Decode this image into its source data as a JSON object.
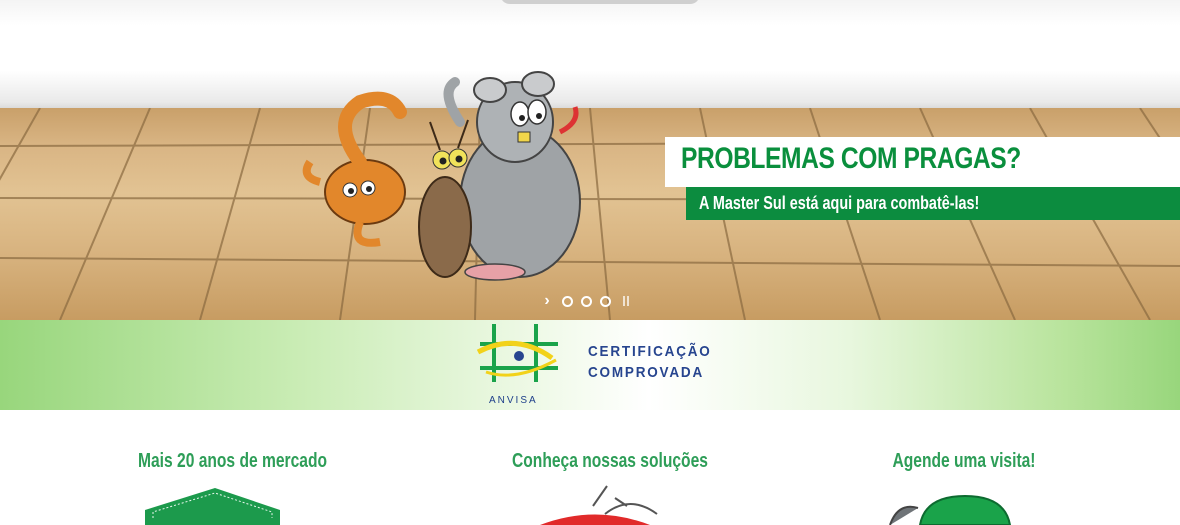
{
  "hero": {
    "title": "PROBLEMAS COM PRAGAS?",
    "subtitle": "A Master Sul está aqui para combatê-las!",
    "slider": {
      "next_arrow": "›",
      "dots": 3
    }
  },
  "certification": {
    "logo_label": "ANVISA",
    "line1": "CERTIFICAÇÃO",
    "line2": "COMPROVADA"
  },
  "features": [
    {
      "title": "Mais 20 anos de mercado"
    },
    {
      "title": "Conheça nossas soluções"
    },
    {
      "title": "Agende uma visita!"
    }
  ],
  "colors": {
    "brand_green": "#0c8c3f",
    "feature_green": "#2e9e58",
    "anvisa_blue": "#27458f"
  }
}
